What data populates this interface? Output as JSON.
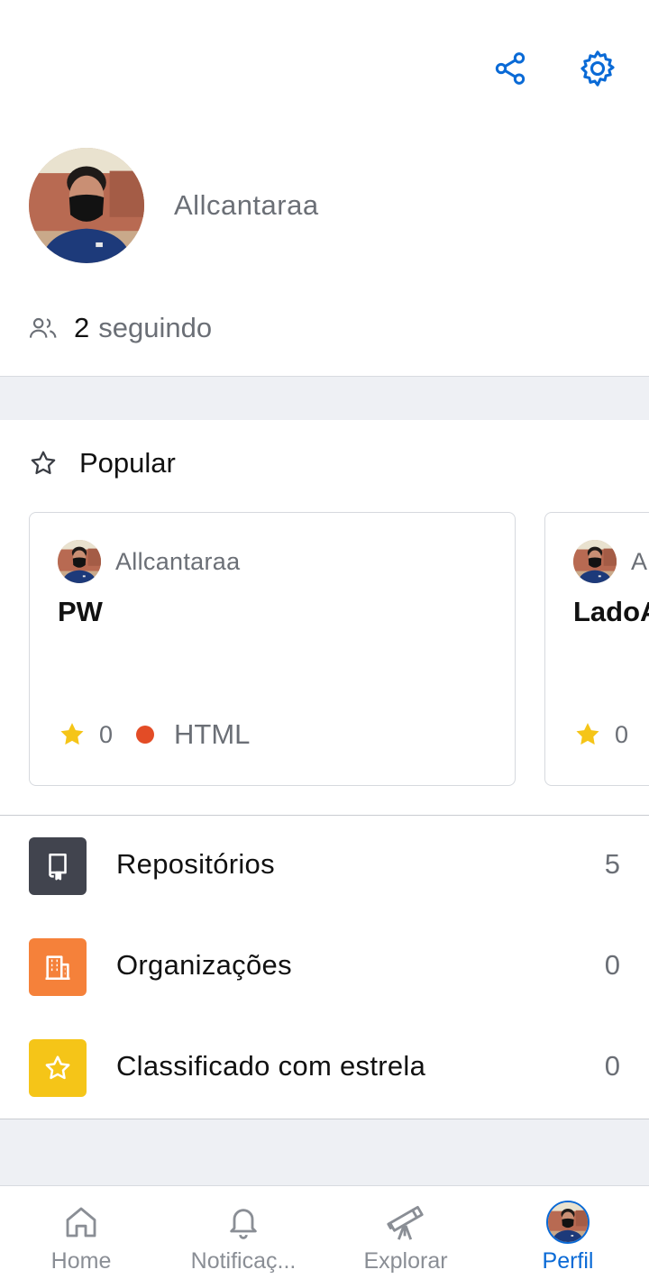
{
  "header": {
    "share_icon": "share-icon",
    "settings_icon": "gear-icon"
  },
  "profile": {
    "username": "Allcantaraa",
    "following_count": "2",
    "following_label": "seguindo"
  },
  "popular": {
    "title": "Popular",
    "repos": [
      {
        "owner": "Allcantaraa",
        "name": "PW",
        "stars": "0",
        "language": "HTML",
        "language_color": "#e34c26"
      },
      {
        "owner": "Allcantaraa",
        "name": "LadoA",
        "stars": "0"
      }
    ]
  },
  "menu": {
    "items": [
      {
        "label": "Repositórios",
        "count": "5",
        "icon": "repo-icon",
        "color": "#41444e"
      },
      {
        "label": "Organizações",
        "count": "0",
        "icon": "organization-icon",
        "color": "#f5813a"
      },
      {
        "label": "Classificado com estrela",
        "count": "0",
        "icon": "star-icon",
        "color": "#f5c518"
      }
    ]
  },
  "tabs": [
    {
      "label": "Home",
      "icon": "home-icon"
    },
    {
      "label": "Notificaç...",
      "icon": "bell-icon"
    },
    {
      "label": "Explorar",
      "icon": "telescope-icon"
    },
    {
      "label": "Perfil",
      "icon": "avatar",
      "active": true
    }
  ],
  "colors": {
    "accent": "#0a6ad6",
    "star": "#f5c518",
    "muted": "#6b6f76"
  }
}
